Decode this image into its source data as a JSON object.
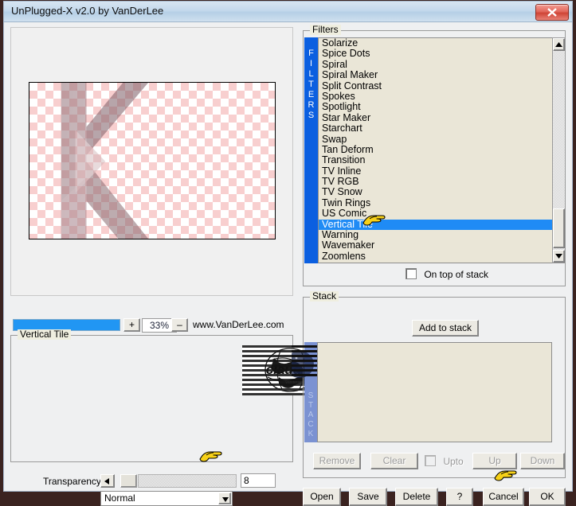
{
  "window": {
    "title": "UnPlugged-X v2.0 by VanDerLee",
    "close_label": "x"
  },
  "preview": {
    "zoom_value": "33%",
    "zoom_in_label": "+",
    "zoom_out_label": "–",
    "website": "www.VanDerLee.com"
  },
  "result_group": {
    "label": "Vertical Tile",
    "logo_text": "claudia"
  },
  "transparency": {
    "label": "Transparency",
    "value": "8",
    "blend_mode": "Normal",
    "blend_modes": [
      "Normal"
    ]
  },
  "filters": {
    "group_label": "Filters",
    "strip_letters": [
      "F",
      "I",
      "L",
      "T",
      "E",
      "R",
      "S"
    ],
    "selected": "Vertical Tile",
    "items": [
      "Solarize",
      "Spice Dots",
      "Spiral",
      "Spiral Maker",
      "Split Contrast",
      "Spokes",
      "Spotlight",
      "Star Maker",
      "Starchart",
      "Swap",
      "Tan Deform",
      "Transition",
      "TV Inline",
      "TV RGB",
      "TV Snow",
      "Twin Rings",
      "US Comic",
      "Vertical Tile",
      "Warning",
      "Wavemaker",
      "Zoomlens"
    ],
    "on_top_of_stack_label": "On top of stack",
    "on_top_of_stack_checked": false
  },
  "stack": {
    "group_label": "Stack",
    "strip_letters": [
      "S",
      "T",
      "A",
      "C",
      "K"
    ],
    "add_label": "Add to stack",
    "items": [],
    "remove_label": "Remove",
    "clear_label": "Clear",
    "upto_label": "Upto",
    "upto_checked": false,
    "up_label": "Up",
    "down_label": "Down"
  },
  "bottom_bar": {
    "open_label": "Open",
    "save_label": "Save",
    "delete_label": "Delete",
    "help_label": "?",
    "cancel_label": "Cancel",
    "ok_label": "OK"
  },
  "colors": {
    "filters_strip": "#0b5fe0",
    "selection": "#1f8bf5",
    "stack_strip": "#7b92d2",
    "list_bg": "#eae6d7",
    "zoom_bar": "#2196f3",
    "close_button": "#cf4436",
    "window_border": "#3b2320"
  }
}
